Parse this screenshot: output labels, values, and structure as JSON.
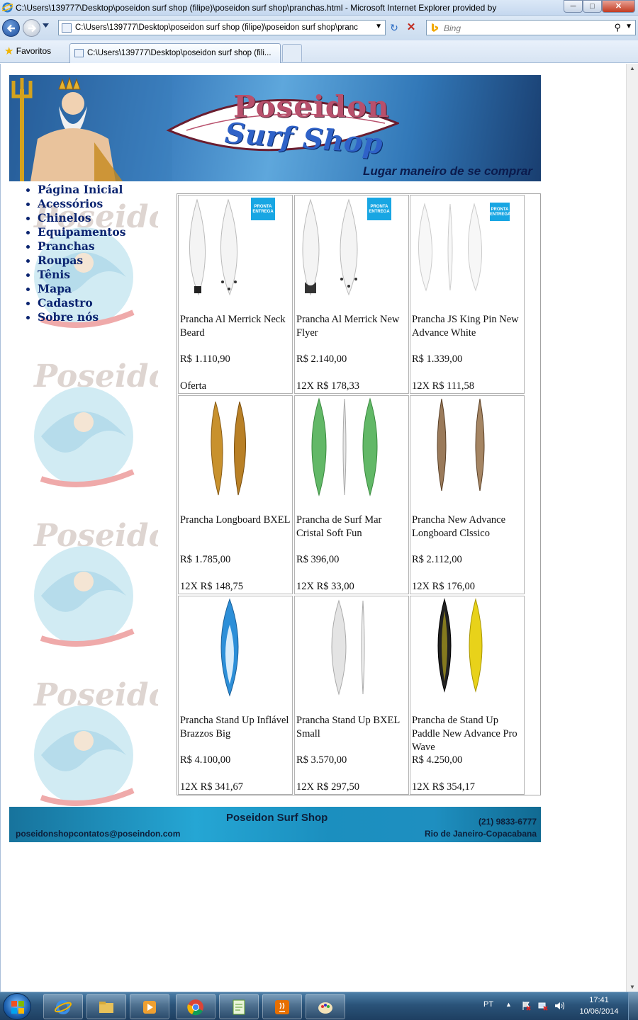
{
  "window": {
    "title": "C:\\Users\\139777\\Desktop\\poseidon surf shop (filipe)\\poseidon surf shop\\pranchas.html - Microsoft Internet Explorer provided by",
    "min_label": "─",
    "max_label": "□",
    "close_label": "✕"
  },
  "address": {
    "url": "C:\\Users\\139777\\Desktop\\poseidon surf shop (filipe)\\poseidon surf shop\\pranc",
    "search_placeholder": "Bing"
  },
  "favorites": {
    "label": "Favoritos",
    "tab_title": "C:\\Users\\139777\\Desktop\\poseidon surf shop (fili..."
  },
  "banner": {
    "brand": "Poseidon",
    "sub": "Surf Shop",
    "tagline": "Lugar maneiro de se comprar"
  },
  "menu": [
    "Página Inicial",
    "Acessórios",
    "Chinelos",
    "Equipamentos",
    "Pranchas",
    "Roupas",
    "Tênis",
    "Mapa",
    "Cadastro",
    "Sobre nós"
  ],
  "badge_text": "PRONTA ENTREGA",
  "products": [
    {
      "name": "Prancha Al Merrick Neck Beard",
      "price": "R$ 1.110,90",
      "installment": "Oferta",
      "badge": true,
      "board_colors": [
        "#f4f4f4",
        "#f4f4f4"
      ],
      "icon": "surfboard-icon"
    },
    {
      "name": "Prancha Al Merrick New Flyer",
      "price": "R$ 2.140,00",
      "installment": "12X R$ 178,33",
      "badge": true,
      "board_colors": [
        "#f4f4f4",
        "#f4f4f4"
      ],
      "icon": "surfboard-icon"
    },
    {
      "name": "Prancha JS King Pin New Advance White",
      "price": "R$ 1.339,00",
      "installment": "12X R$ 111,58",
      "badge": true,
      "board_colors": [
        "#f7f7f7",
        "#f7f7f7"
      ],
      "icon": "surfboard-icon"
    },
    {
      "name": "Prancha Longboard BXEL",
      "price": "R$ 1.785,00",
      "installment": "12X R$ 148,75",
      "badge": false,
      "board_colors": [
        "#c8912d",
        "#b98026"
      ],
      "icon": "longboard-icon"
    },
    {
      "name": "Prancha de Surf Mar Cristal Soft Fun",
      "price": "R$ 396,00",
      "installment": "12X R$ 33,00",
      "badge": false,
      "board_colors": [
        "#62b867",
        "#62b867"
      ],
      "icon": "softboard-icon"
    },
    {
      "name": "Prancha New Advance Longboard Clssico",
      "price": "R$ 2.112,00",
      "installment": "12X R$ 176,00",
      "badge": false,
      "board_colors": [
        "#9a7a5a",
        "#a58563"
      ],
      "icon": "longboard-icon"
    },
    {
      "name": "Prancha Stand Up Inflável Brazzos Big",
      "price": "R$ 4.100,00",
      "installment": "12X R$ 341,67",
      "badge": false,
      "board_colors": [
        "#2d8fd8"
      ],
      "icon": "sup-board-icon"
    },
    {
      "name": "Prancha Stand Up BXEL Small",
      "price": "R$ 3.570,00",
      "installment": "12X R$ 297,50",
      "badge": false,
      "board_colors": [
        "#e4e4e4"
      ],
      "icon": "sup-board-icon"
    },
    {
      "name": "Prancha de Stand Up Paddle New Advance Pro Wave",
      "price": "R$ 4.250,00",
      "installment": "12X R$ 354,17",
      "badge": false,
      "board_colors": [
        "#222222",
        "#e8d21a"
      ],
      "icon": "sup-board-icon"
    }
  ],
  "footer": {
    "title": "Poseidon Surf Shop",
    "email": "poseidonshopcontatos@poseindon.com",
    "phone": "(21) 9833-6777",
    "city": "Rio de Janeiro-Copacabana"
  },
  "taskbar": {
    "lang": "PT",
    "time": "17:41",
    "date": "10/06/2014"
  },
  "colors": {
    "menu_link": "#0b2470",
    "badge": "#18a6e3",
    "footer_bg": "#25a6d4"
  }
}
